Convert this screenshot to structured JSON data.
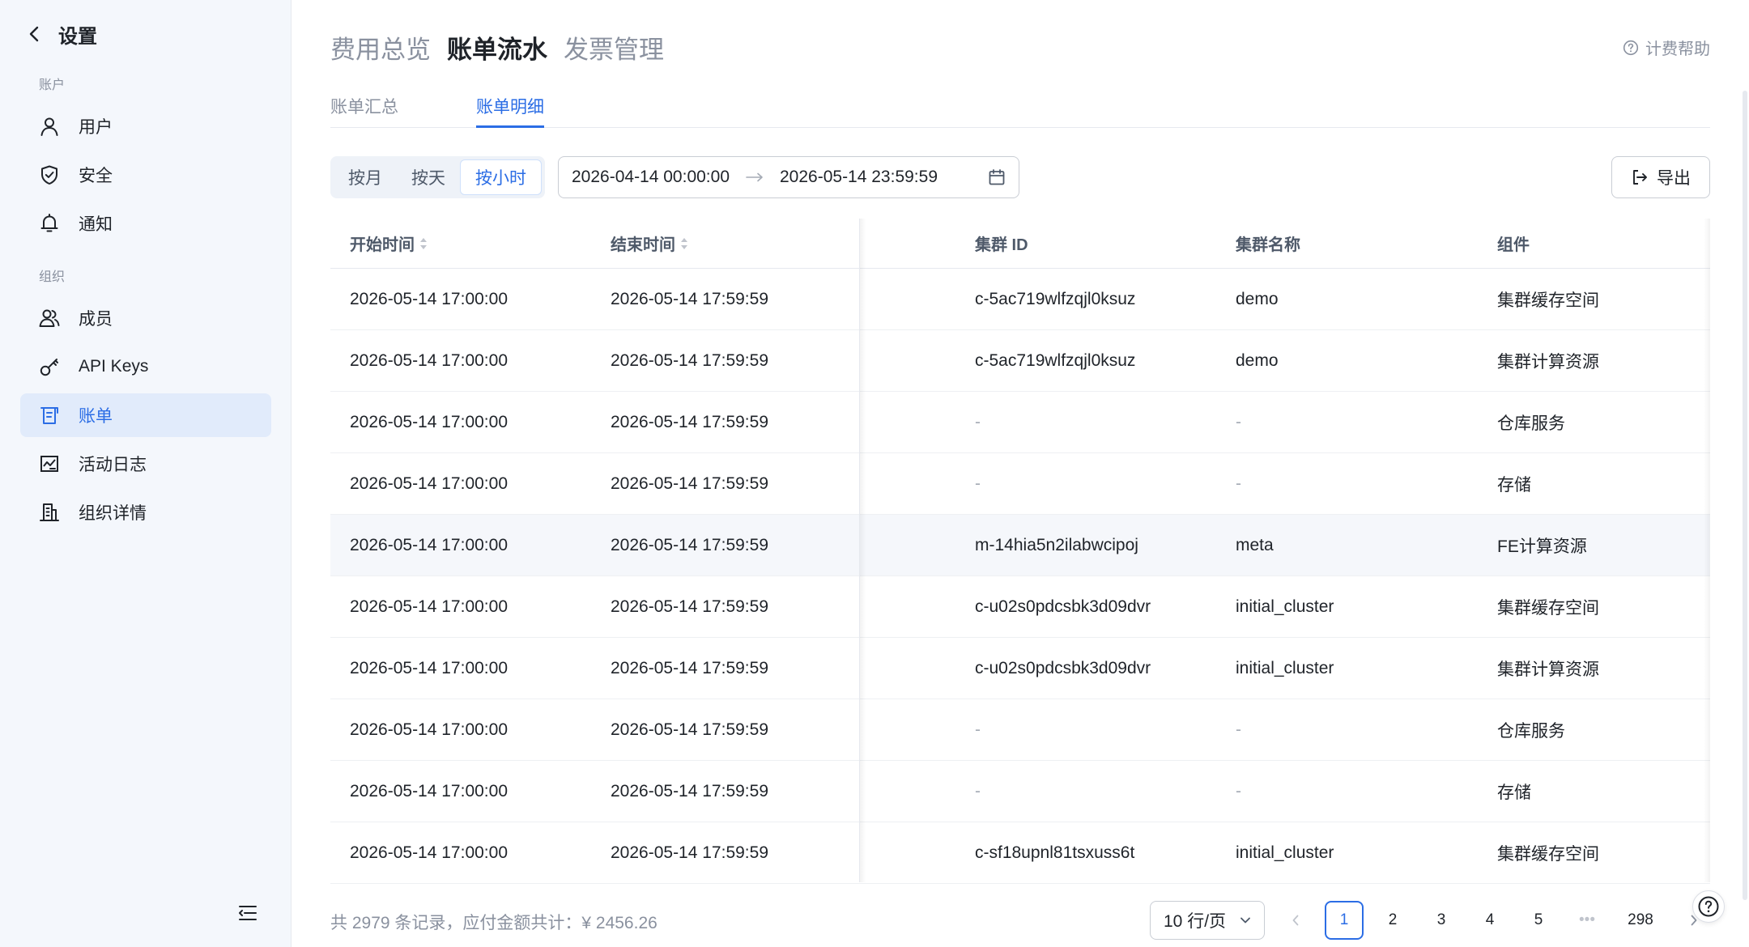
{
  "sidebar": {
    "title": "设置",
    "section_account": "账户",
    "section_org": "组织",
    "items": [
      {
        "label": "用户"
      },
      {
        "label": "安全"
      },
      {
        "label": "通知"
      },
      {
        "label": "成员"
      },
      {
        "label": "API Keys"
      },
      {
        "label": "账单"
      },
      {
        "label": "活动日志"
      },
      {
        "label": "组织详情"
      }
    ]
  },
  "header": {
    "tabs": [
      "费用总览",
      "账单流水",
      "发票管理"
    ],
    "active_tab": "账单流水",
    "help_label": "计费帮助"
  },
  "subtabs": {
    "items": [
      "账单汇总",
      "账单明细"
    ],
    "active": "账单明细"
  },
  "filters": {
    "granularity": [
      "按月",
      "按天",
      "按小时"
    ],
    "active_granularity": "按小时",
    "start": "2026-04-14 00:00:00",
    "end": "2026-05-14 23:59:59",
    "export_label": "导出"
  },
  "table": {
    "columns": [
      "开始时间",
      "结束时间",
      "集群 ID",
      "集群名称",
      "组件"
    ],
    "rows": [
      [
        "2026-05-14 17:00:00",
        "2026-05-14 17:59:59",
        "c-5ac719wlfzqjl0ksuz",
        "demo",
        "集群缓存空间"
      ],
      [
        "2026-05-14 17:00:00",
        "2026-05-14 17:59:59",
        "c-5ac719wlfzqjl0ksuz",
        "demo",
        "集群计算资源"
      ],
      [
        "2026-05-14 17:00:00",
        "2026-05-14 17:59:59",
        "-",
        "-",
        "仓库服务"
      ],
      [
        "2026-05-14 17:00:00",
        "2026-05-14 17:59:59",
        "-",
        "-",
        "存储"
      ],
      [
        "2026-05-14 17:00:00",
        "2026-05-14 17:59:59",
        "m-14hia5n2ilabwcipoj",
        "meta",
        "FE计算资源"
      ],
      [
        "2026-05-14 17:00:00",
        "2026-05-14 17:59:59",
        "c-u02s0pdcsbk3d09dvr",
        "initial_cluster",
        "集群缓存空间"
      ],
      [
        "2026-05-14 17:00:00",
        "2026-05-14 17:59:59",
        "c-u02s0pdcsbk3d09dvr",
        "initial_cluster",
        "集群计算资源"
      ],
      [
        "2026-05-14 17:00:00",
        "2026-05-14 17:59:59",
        "-",
        "-",
        "仓库服务"
      ],
      [
        "2026-05-14 17:00:00",
        "2026-05-14 17:59:59",
        "-",
        "-",
        "存储"
      ],
      [
        "2026-05-14 17:00:00",
        "2026-05-14 17:59:59",
        "c-sf18upnl81tsxuss6t",
        "initial_cluster",
        "集群缓存空间"
      ]
    ]
  },
  "footer": {
    "summary": "共 2979 条记录，应付金额共计：¥ 2456.26",
    "page_size": "10 行/页",
    "pages": [
      "1",
      "2",
      "3",
      "4",
      "5"
    ],
    "ellipsis": "•••",
    "last_page": "298",
    "current_page": "1"
  },
  "colors": {
    "accent": "#2b6de5",
    "sidebar_bg": "#f4f7fc",
    "active_item_bg": "#e1ebfb"
  }
}
